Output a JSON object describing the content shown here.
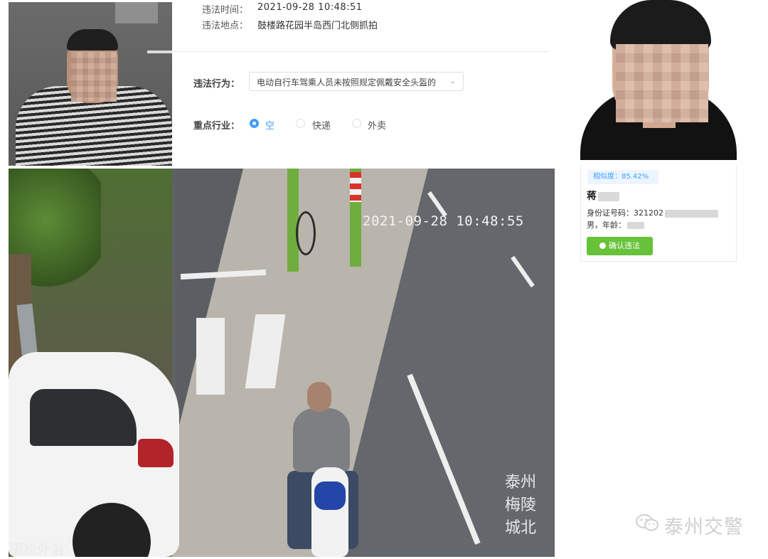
{
  "violation": {
    "time_label": "违法时间：",
    "time_value": "2021-09-28 10:48:51",
    "place_label": "违法地点：",
    "place_value": "鼓楼路花园半岛西门北侧抓拍",
    "behavior_label": "违法行为：",
    "behavior_value": "电动自行车驾乘人员未按照规定佩戴安全头盔的",
    "industry_label": "重点行业：",
    "industry_options": [
      {
        "label": "空",
        "selected": true
      },
      {
        "label": "快递",
        "selected": false
      },
      {
        "label": "外卖",
        "selected": false
      }
    ]
  },
  "scene": {
    "timestamp": "2021-09-28 10:48:55",
    "overlay_bottom_left": "固松外浴",
    "overlay_right": [
      "泰州",
      "梅陵",
      "城北"
    ]
  },
  "match_card": {
    "similarity": "相似度：85.42%",
    "name_visible": "蒋",
    "id_label": "身份证号码：",
    "id_prefix": "321202",
    "gender_age": "男，年龄：",
    "confirm_label": "确认违法"
  },
  "watermark": {
    "text": "泰州交警",
    "icon": "wechat-icon"
  },
  "colors": {
    "accent_blue": "#409eff",
    "confirm_green": "#67c23a"
  }
}
